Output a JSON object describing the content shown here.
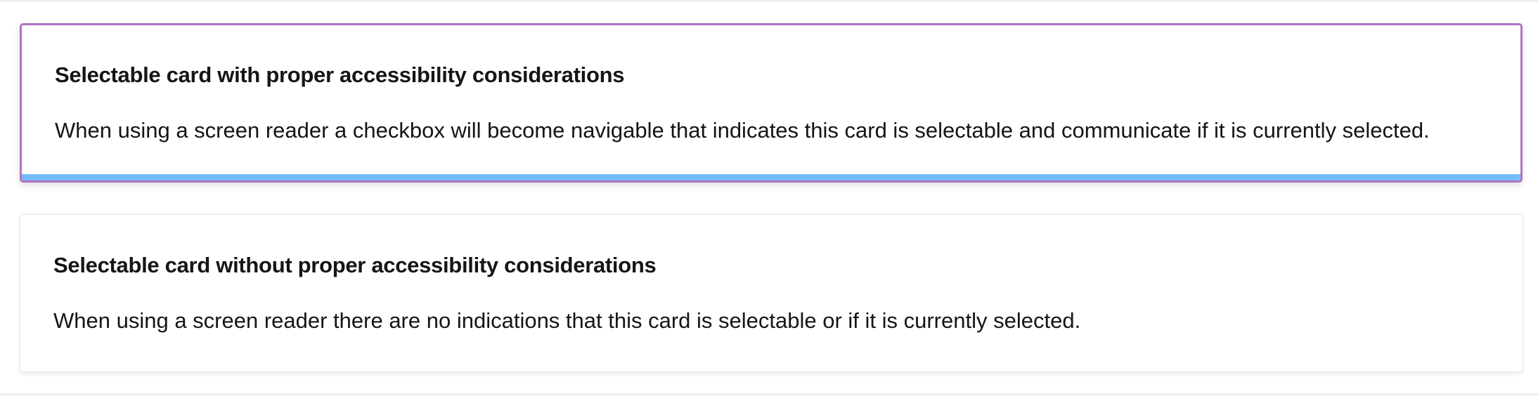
{
  "cards": [
    {
      "title": "Selectable card with proper accessibility considerations",
      "body": "When using a screen reader a checkbox will become navigable that indicates this card is selectable and communicate if it is currently selected.",
      "selected": true
    },
    {
      "title": "Selectable card without proper accessibility considerations",
      "body": "When using a screen reader there are no indications that this card is selectable or if it is currently selected.",
      "selected": false
    }
  ],
  "colors": {
    "selected_border": "#b173c2",
    "selected_bar": "#73bcf7",
    "text": "#151515"
  }
}
